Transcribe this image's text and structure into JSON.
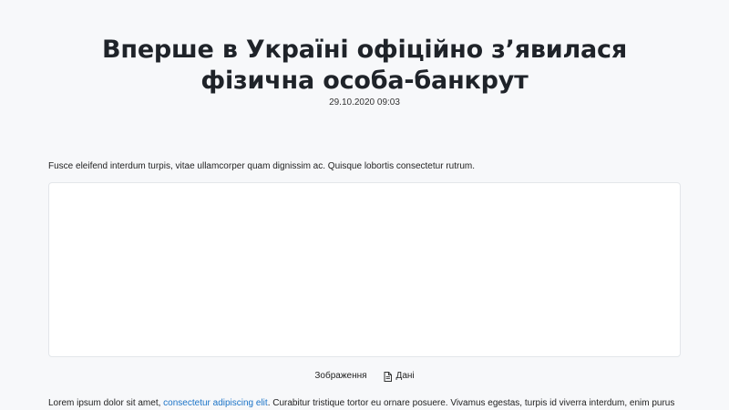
{
  "article": {
    "title": "Вперше в Україні офіційно з’явилася фізична особа-банкрут",
    "date": "29.10.2020 09:03",
    "intro": "Fusce eleifend interdum turpis, vitae ullamcorper quam dignissim ac. Quisque lobortis consectetur rutrum.",
    "media": {
      "tab_image": "Зображення",
      "tab_data": "Дані",
      "tab_data_icon": "document-icon"
    },
    "body": {
      "before_link": "Lorem ipsum dolor sit amet, ",
      "link_text": "consectetur adipiscing elit",
      "after_link": ". Curabitur tristique tortor eu ornare posuere. Vivamus egestas, turpis id viverra interdum, enim purus"
    }
  },
  "colors": {
    "background": "#f7f8fa",
    "link": "#1a73c7",
    "frame_border": "#e3e6ea"
  }
}
